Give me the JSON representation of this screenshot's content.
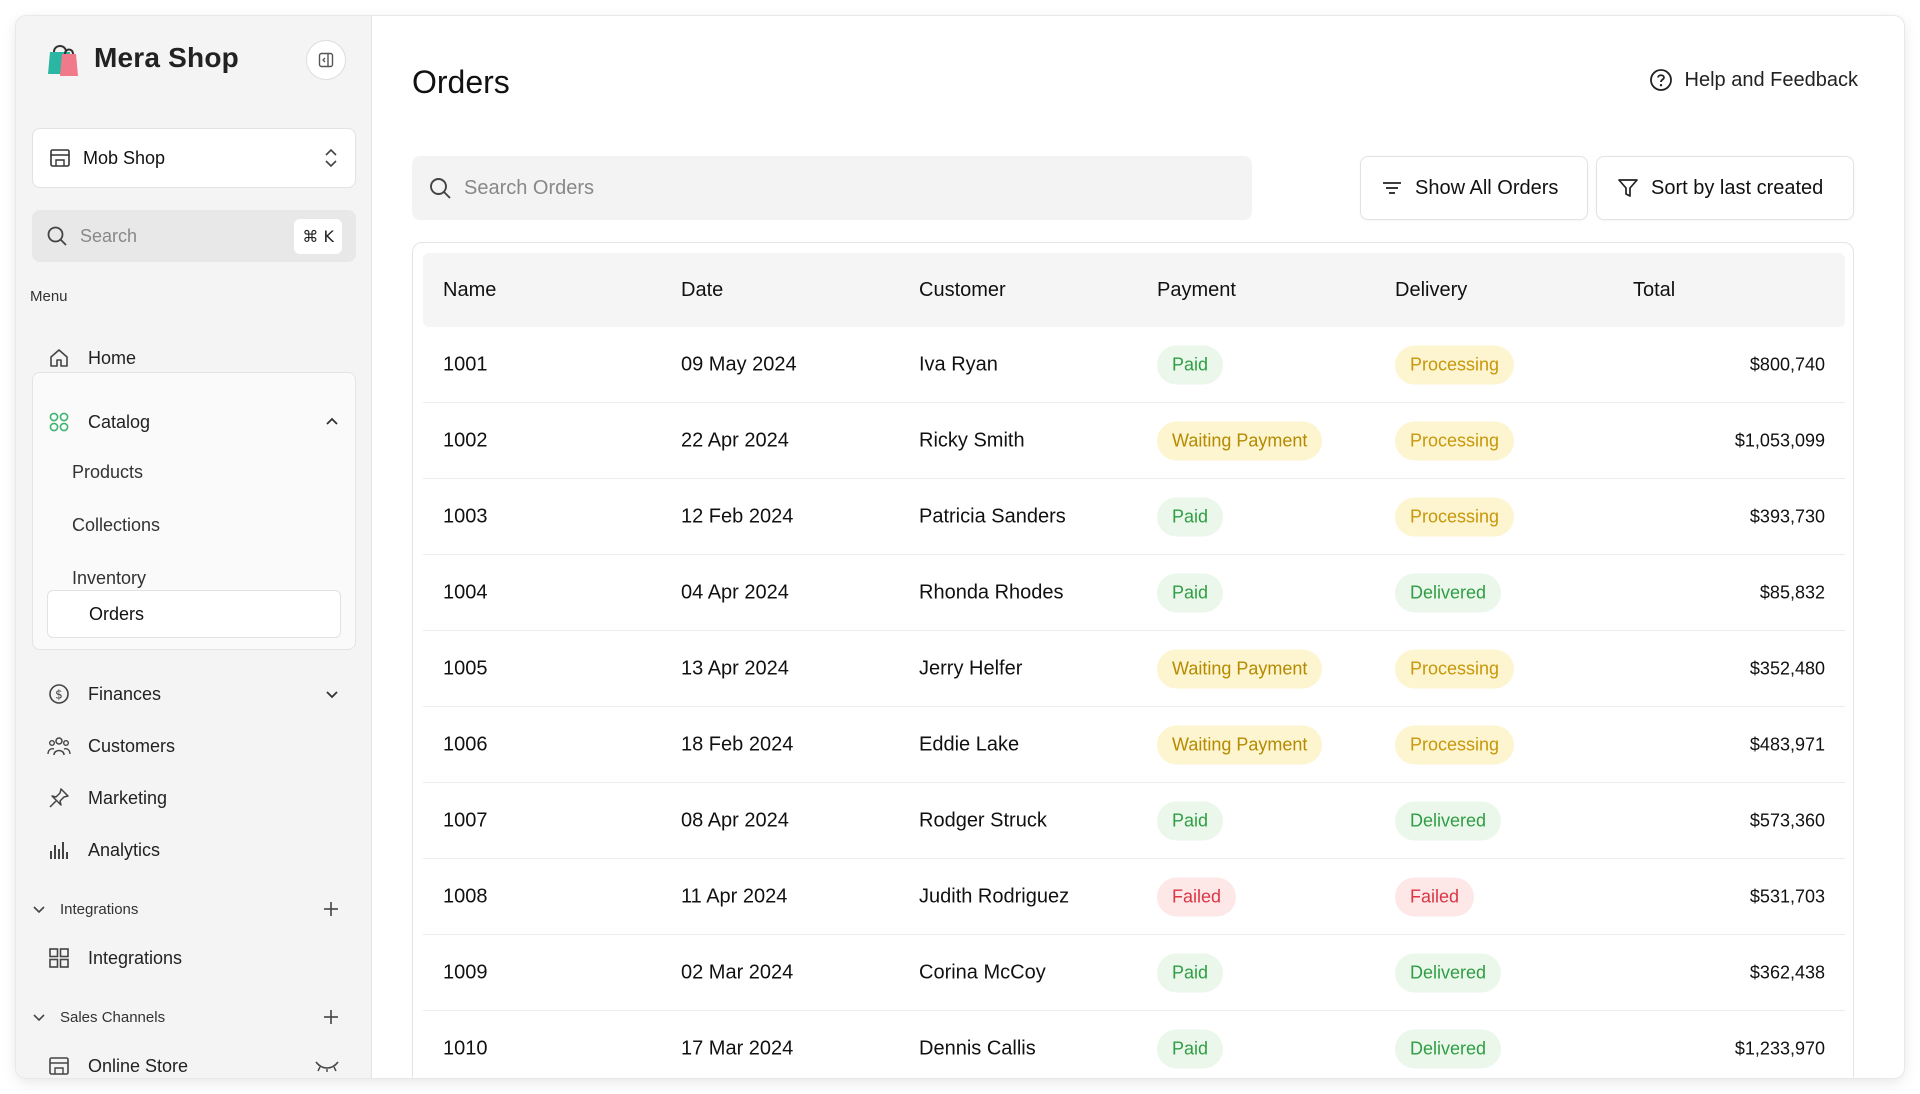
{
  "app": {
    "name": "Mera Shop",
    "logo_icon": "shopping-bag-icon"
  },
  "sidebar": {
    "store_select": {
      "label": "Mob Shop"
    },
    "search": {
      "placeholder": "Search",
      "shortcut": "⌘ K"
    },
    "menu_label": "Menu",
    "home": "Home",
    "catalog": {
      "label": "Catalog",
      "items": [
        "Products",
        "Collections",
        "Inventory",
        "Orders"
      ],
      "active": "Orders"
    },
    "finances": "Finances",
    "customers": "Customers",
    "marketing": "Marketing",
    "analytics": "Analytics",
    "integrations_section": "Integrations",
    "integrations_item": "Integrations",
    "sales_channels_section": "Sales Channels",
    "online_store": "Online Store"
  },
  "main": {
    "title": "Orders",
    "help": "Help and Feedback",
    "search_placeholder": "Search Orders",
    "show_all_orders": "Show All Orders",
    "sort_label": "Sort by last created",
    "columns": [
      "Name",
      "Date",
      "Customer",
      "Payment",
      "Delivery",
      "Total"
    ],
    "rows": [
      {
        "name": "1001",
        "date": "09 May 2024",
        "customer": "Iva Ryan",
        "payment": "Paid",
        "delivery": "Processing",
        "total": "$800,740"
      },
      {
        "name": "1002",
        "date": "22 Apr 2024",
        "customer": "Ricky Smith",
        "payment": "Waiting Payment",
        "delivery": "Processing",
        "total": "$1,053,099"
      },
      {
        "name": "1003",
        "date": "12 Feb 2024",
        "customer": "Patricia Sanders",
        "payment": "Paid",
        "delivery": "Processing",
        "total": "$393,730"
      },
      {
        "name": "1004",
        "date": "04 Apr 2024",
        "customer": "Rhonda Rhodes",
        "payment": "Paid",
        "delivery": "Delivered",
        "total": "$85,832"
      },
      {
        "name": "1005",
        "date": "13 Apr 2024",
        "customer": "Jerry Helfer",
        "payment": "Waiting Payment",
        "delivery": "Processing",
        "total": "$352,480"
      },
      {
        "name": "1006",
        "date": "18 Feb 2024",
        "customer": "Eddie Lake",
        "payment": "Waiting Payment",
        "delivery": "Processing",
        "total": "$483,971"
      },
      {
        "name": "1007",
        "date": "08 Apr 2024",
        "customer": "Rodger Struck",
        "payment": "Paid",
        "delivery": "Delivered",
        "total": "$573,360"
      },
      {
        "name": "1008",
        "date": "11 Apr 2024",
        "customer": "Judith Rodriguez",
        "payment": "Failed",
        "delivery": "Failed",
        "total": "$531,703"
      },
      {
        "name": "1009",
        "date": "02 Mar 2024",
        "customer": "Corina McCoy",
        "payment": "Paid",
        "delivery": "Delivered",
        "total": "$362,438"
      },
      {
        "name": "1010",
        "date": "17 Mar 2024",
        "customer": "Dennis Callis",
        "payment": "Paid",
        "delivery": "Delivered",
        "total": "$1,233,970"
      }
    ]
  },
  "colors": {
    "paid": "#2f9e45",
    "waiting": "#b58a00",
    "failed": "#dc3545",
    "catalog_icon": "#3cb371"
  }
}
